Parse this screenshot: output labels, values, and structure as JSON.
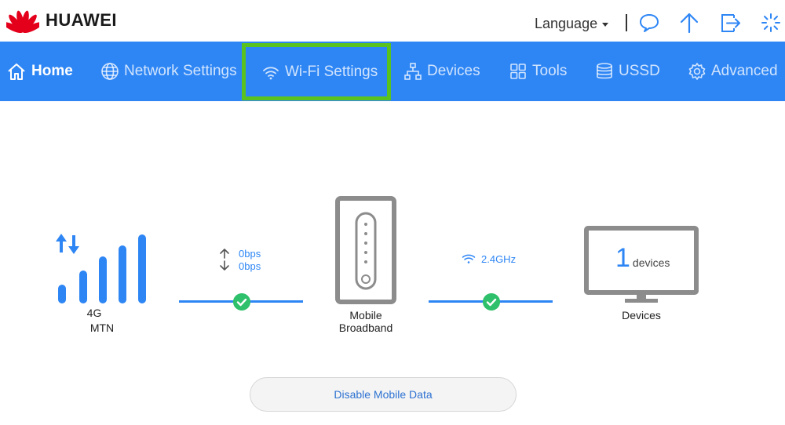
{
  "header": {
    "brand": "HUAWEI",
    "language_label": "Language",
    "icons": [
      "chat-icon",
      "upload-icon",
      "logout-icon",
      "loading-icon"
    ]
  },
  "nav": {
    "items": [
      {
        "label": "Home",
        "icon": "home-icon"
      },
      {
        "label": "Network Settings",
        "icon": "globe-icon"
      },
      {
        "label": "Wi-Fi Settings",
        "icon": "wifi-icon"
      },
      {
        "label": "Devices",
        "icon": "network-tree-icon"
      },
      {
        "label": "Tools",
        "icon": "grid-icon"
      },
      {
        "label": "USSD",
        "icon": "database-icon"
      },
      {
        "label": "Advanced",
        "icon": "gear-icon"
      }
    ]
  },
  "status": {
    "network_type": "4G",
    "operator": "MTN",
    "upload_rate": "0bps",
    "download_rate": "0bps",
    "router_label_line1": "Mobile",
    "router_label_line2": "Broadband",
    "wifi_band": "2.4GHz",
    "device_count": "1",
    "device_count_unit": "devices",
    "devices_label": "Devices"
  },
  "actions": {
    "disable_mobile_data": "Disable Mobile Data"
  },
  "colors": {
    "accent": "#2e86f5",
    "highlight": "#5ac21f",
    "ok": "#2fc06b",
    "device_gray": "#8c8c8c"
  }
}
